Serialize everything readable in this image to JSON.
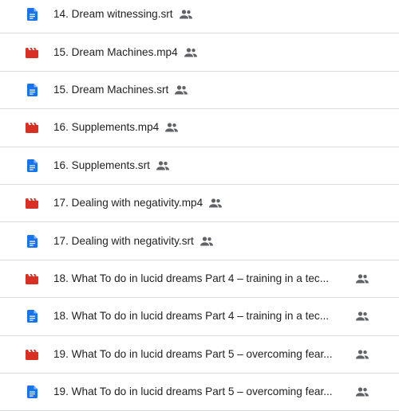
{
  "colors": {
    "doc_blue": "#1a73e8",
    "video_red": "#d93025",
    "shared_gray": "#5f6368",
    "divider": "#dadce0"
  },
  "files": [
    {
      "name": "14. Dream witnessing.srt",
      "type": "doc-file-icon",
      "shared": true
    },
    {
      "name": "15. Dream Machines.mp4",
      "type": "video-file-icon",
      "shared": true
    },
    {
      "name": "15. Dream Machines.srt",
      "type": "doc-file-icon",
      "shared": true
    },
    {
      "name": "16. Supplements.mp4",
      "type": "video-file-icon",
      "shared": true
    },
    {
      "name": "16. Supplements.srt",
      "type": "doc-file-icon",
      "shared": true
    },
    {
      "name": "17. Dealing with negativity.mp4",
      "type": "video-file-icon",
      "shared": true
    },
    {
      "name": "17. Dealing with negativity.srt",
      "type": "doc-file-icon",
      "shared": true
    },
    {
      "name": "18. What To do in lucid dreams Part 4 – training in a tec...",
      "type": "video-file-icon",
      "shared": true
    },
    {
      "name": "18. What To do in lucid dreams Part 4 – training in a tec...",
      "type": "doc-file-icon",
      "shared": true
    },
    {
      "name": "19. What To do in lucid dreams Part 5 – overcoming fear...",
      "type": "video-file-icon",
      "shared": true
    },
    {
      "name": "19. What To do in lucid dreams Part 5 – overcoming fear...",
      "type": "doc-file-icon",
      "shared": true
    }
  ],
  "icons": {
    "shared": "people-shared-icon"
  }
}
